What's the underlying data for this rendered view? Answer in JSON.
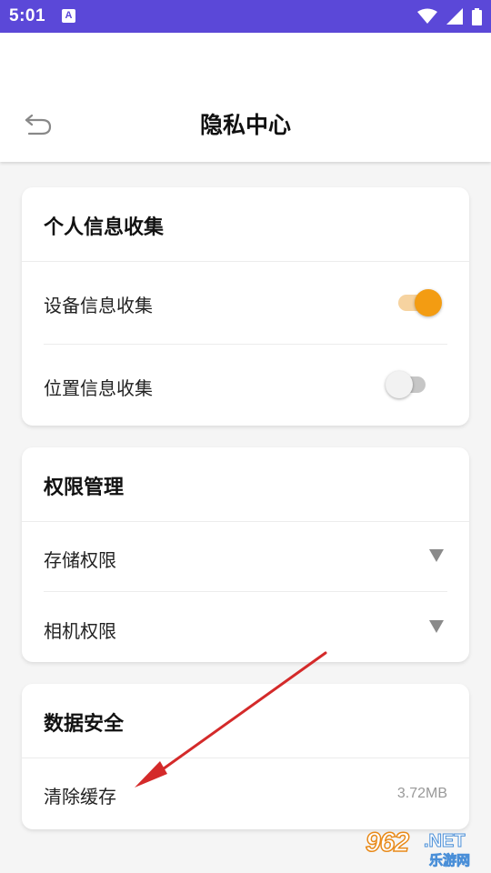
{
  "status_bar": {
    "time": "5:01",
    "app_icon_letter": "A",
    "background_color": "#5b48d8",
    "icons": [
      "wifi-icon",
      "signal-icon",
      "battery-icon"
    ]
  },
  "header": {
    "title": "隐私中心",
    "back_icon": "back-arrow-icon"
  },
  "sections": {
    "personal_info": {
      "title": "个人信息收集",
      "device_info": {
        "label": "设备信息收集",
        "enabled": true
      },
      "location_info": {
        "label": "位置信息收集",
        "enabled": false
      }
    },
    "permissions": {
      "title": "权限管理",
      "storage": {
        "label": "存储权限"
      },
      "camera": {
        "label": "相机权限"
      }
    },
    "data_security": {
      "title": "数据安全",
      "clear_cache": {
        "label": "清除缓存",
        "size": "3.72MB"
      }
    }
  },
  "colors": {
    "toggle_on": "#f39c12",
    "annotation_arrow": "#d42a2a"
  },
  "watermark": {
    "number": "962",
    "suffix": ".NET",
    "sub": "乐游网"
  }
}
